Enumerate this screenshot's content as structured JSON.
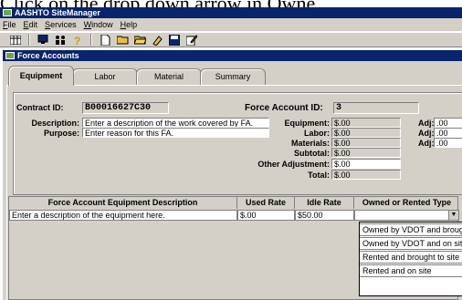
{
  "overlay_text": "Click on the drop down arrow in Owne",
  "app": {
    "title": "AASHTO SiteManager"
  },
  "menu": [
    "File",
    "Edit",
    "Services",
    "Window",
    "Help"
  ],
  "toolbar_icons": [
    "grid-icon",
    "monitor-icon",
    "people-icon",
    "question-icon",
    "new-doc-icon",
    "open-folder-icon",
    "folder-icon",
    "highlighter-icon",
    "save-icon",
    "edit-icon"
  ],
  "window": {
    "title": "Force Accounts"
  },
  "tabs": [
    {
      "label": "Equipment",
      "active": true
    },
    {
      "label": "Labor",
      "active": false
    },
    {
      "label": "Material",
      "active": false
    },
    {
      "label": "Summary",
      "active": false
    }
  ],
  "form": {
    "contract_id_label": "Contract ID:",
    "contract_id_value": "B00016627C30",
    "fa_id_label": "Force Account ID:",
    "fa_id_value": "3",
    "description_label": "Description:",
    "description_value": "Enter a description of the work covered by FA.",
    "purpose_label": "Purpose:",
    "purpose_value": "Enter reason for this FA.",
    "equipment_label": "Equipment:",
    "equipment_value": "$.00",
    "labor_label": "Labor:",
    "labor_value": "$.00",
    "materials_label": "Materials:",
    "materials_value": "$.00",
    "subtotal_label": "Subtotal:",
    "subtotal_value": "$.00",
    "other_adj_label": "Other Adjustment:",
    "other_adj_value": "$.00",
    "total_label": "Total:",
    "total_value": "$.00",
    "adj_label": "Adj:",
    "adj_values": [
      ".00",
      ".00",
      ".00"
    ]
  },
  "grid": {
    "headers": [
      "Force Account Equipment Description",
      "Used Rate",
      "Idle Rate",
      "Owned or Rented Type"
    ],
    "row": {
      "description": "Enter a description of the equipment here.",
      "used_rate": "$.00",
      "idle_rate": "$50.00",
      "type": ""
    }
  },
  "dropdown_options": [
    "Owned by VDOT and brought to site",
    "Owned by VDOT and on site",
    "Rented and brought to site",
    "Rented and on site"
  ]
}
